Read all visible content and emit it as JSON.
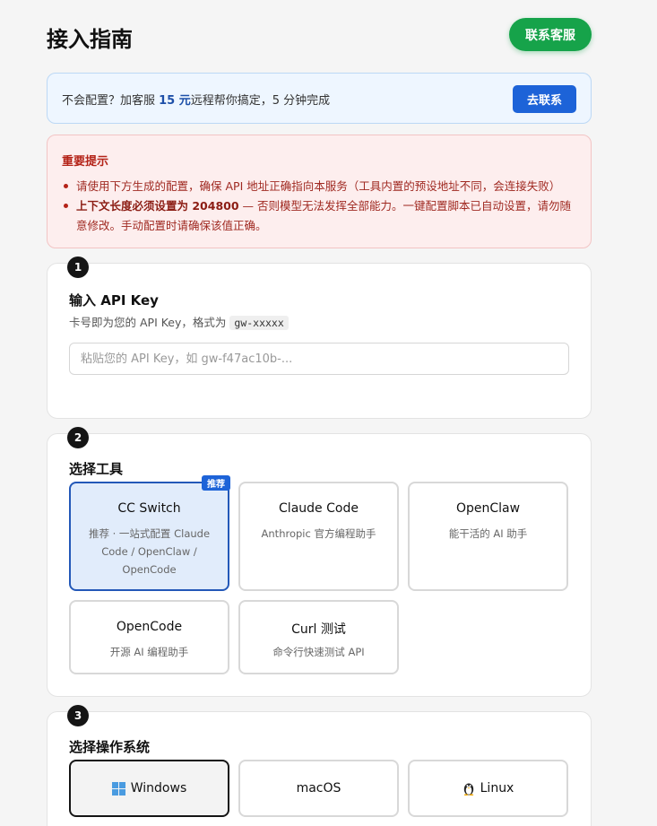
{
  "header": {
    "title": "接入指南",
    "support_button": "联系客服"
  },
  "banner": {
    "text_before": "不会配置？加客服 ",
    "price": "15 元",
    "text_after": "远程帮你搞定，5 分钟完成",
    "button": "去联系"
  },
  "warning": {
    "title": "重要提示",
    "item1": "请使用下方生成的配置，确保 API 地址正确指向本服务（工具内置的预设地址不同，会连接失败）",
    "item2_bold": "上下文长度必须设置为 204800",
    "item2_rest": " — 否则模型无法发挥全部能力。一键配置脚本已自动设置，请勿随意修改。手动配置时请确保该值正确。"
  },
  "step1": {
    "number": "1",
    "title": "输入 API Key",
    "desc": "卡号即为您的 API Key，格式为",
    "format": "gw-xxxxx",
    "placeholder": "粘贴您的 API Key，如 gw-f47ac10b-..."
  },
  "step2": {
    "number": "2",
    "title": "选择工具",
    "recommend_badge": "推荐",
    "tools": [
      {
        "name": "CC Switch",
        "desc": "推荐 · 一站式配置 Claude Code / OpenClaw / OpenCode",
        "selected": true
      },
      {
        "name": "Claude Code",
        "desc": "Anthropic 官方编程助手",
        "selected": false
      },
      {
        "name": "OpenClaw",
        "desc": "能干活的 AI 助手",
        "selected": false
      },
      {
        "name": "OpenCode",
        "desc": "开源 AI 编程助手",
        "selected": false
      },
      {
        "name": "Curl 测试",
        "desc": "命令行快速测试 API",
        "selected": false
      }
    ]
  },
  "step3": {
    "number": "3",
    "title": "选择操作系统",
    "os": [
      {
        "name": "Windows",
        "icon": "windows-icon",
        "selected": true
      },
      {
        "name": "macOS",
        "icon": "",
        "selected": false
      },
      {
        "name": "Linux",
        "icon": "penguin-icon",
        "selected": false
      }
    ]
  },
  "colors": {
    "accent_blue": "#1d63d8",
    "support_green": "#16a34a",
    "warning_red": "#b42318",
    "selected_tool_bg": "#e1ecfb"
  }
}
